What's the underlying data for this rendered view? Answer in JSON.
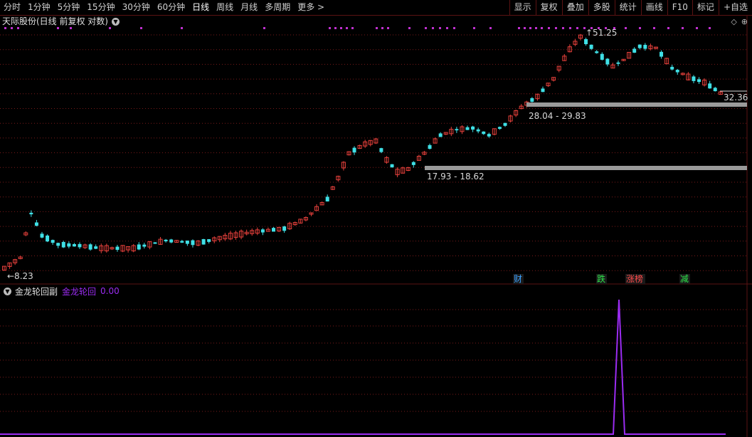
{
  "toolbar": {
    "periods": [
      "分时",
      "1分钟",
      "5分钟",
      "15分钟",
      "30分钟",
      "60分钟",
      "日线",
      "周线",
      "月线",
      "多周期",
      "更多 >"
    ],
    "active_period": "日线",
    "right_items": [
      "显示",
      "复权",
      "叠加",
      "多股",
      "统计",
      "画线",
      "F10",
      "标记",
      "+自选"
    ]
  },
  "chart_header": {
    "title": "天际股份(日线 前复权 对数)",
    "icon": "chevron-down-icon"
  },
  "corner_icons": [
    "diamond-icon",
    "circle-plus-icon"
  ],
  "price_labels": {
    "high": "51.25",
    "low": "8.23",
    "last": "32.36"
  },
  "zones": [
    {
      "label": "28.04 - 29.83",
      "low": 28.04,
      "high": 29.83
    },
    {
      "label": "17.93 - 18.62",
      "low": 17.93,
      "high": 18.62
    }
  ],
  "event_tags": [
    {
      "text": "财",
      "color": "#3aa0ff"
    },
    {
      "text": "跌",
      "color": "#2ee64a"
    },
    {
      "text": "涨榜",
      "color": "#ff4a4a"
    },
    {
      "text": "减",
      "color": "#2ee64a"
    }
  ],
  "indicator": {
    "name": "金龙轮回副",
    "series_name": "金龙轮回",
    "value": "0.00",
    "color": "#9b2cf2"
  },
  "colors": {
    "up": "#e8413c",
    "down": "#3fe0e6",
    "grid": "#7a1a1a",
    "zone": "#9a9a9a",
    "marker": "#c030d0"
  }
}
